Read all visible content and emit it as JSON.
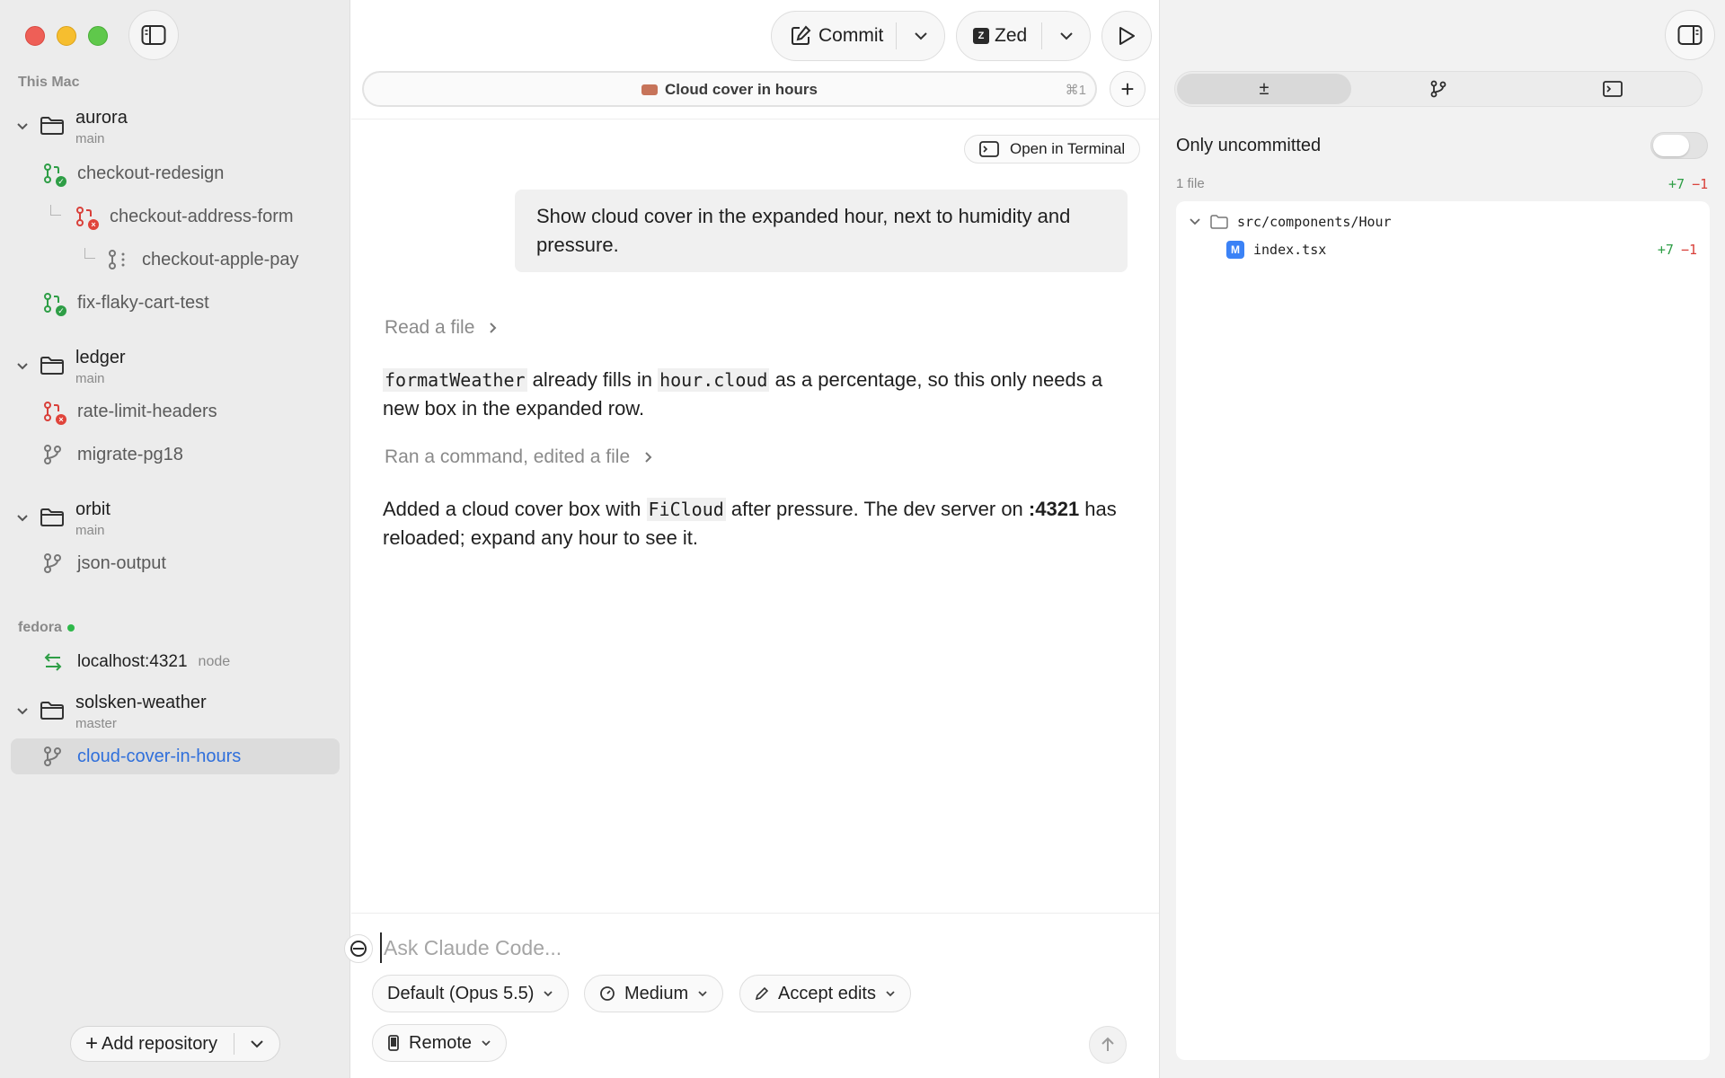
{
  "sidebar": {
    "section_this_mac": "This Mac",
    "repos": [
      {
        "name": "aurora",
        "branch": "main"
      },
      {
        "name": "ledger",
        "branch": "main"
      },
      {
        "name": "orbit",
        "branch": "main"
      },
      {
        "name": "solsken-weather",
        "branch": "master"
      }
    ],
    "branches": {
      "checkout_redesign": "checkout-redesign",
      "checkout_address_form": "checkout-address-form",
      "checkout_apple_pay": "checkout-apple-pay",
      "fix_flaky_cart_test": "fix-flaky-cart-test",
      "rate_limit_headers": "rate-limit-headers",
      "migrate_pg18": "migrate-pg18",
      "json_output": "json-output",
      "cloud_cover_in_hours": "cloud-cover-in-hours"
    },
    "host_section": "fedora",
    "host_status_color": "#2eb84a",
    "localhost": {
      "label": "localhost:4321",
      "process": "node"
    },
    "add_repository": "Add repository"
  },
  "toolbar": {
    "commit_label": "Commit",
    "editor_label": "Zed"
  },
  "tab": {
    "title": "Cloud cover in hours",
    "shortcut": "⌘1"
  },
  "conversation": {
    "open_in_terminal": "Open in Terminal",
    "user_message": "Show cloud cover in the expanded hour, next to humidity and pressure.",
    "step1": "Read a file",
    "msg1": {
      "code1": "formatWeather",
      "t1": " already fills in ",
      "code2": "hour.cloud",
      "t2": " as a percentage, so this only needs a new box in the expanded row."
    },
    "step2": "Ran a command, edited a file",
    "msg2": {
      "t1": "Added a cloud cover box with ",
      "code1": "FiCloud",
      "t2": " after pressure. The dev server on ",
      "bold1": ":4321",
      "t3": " has reloaded; expand any hour to see it."
    }
  },
  "composer": {
    "placeholder": "Ask Claude Code...",
    "model": "Default (Opus 5.5)",
    "effort": "Medium",
    "permission": "Accept edits",
    "environment": "Remote"
  },
  "right_panel": {
    "tabs": [
      "±",
      "branch-icon",
      "terminal-icon"
    ],
    "only_uncommitted": "Only uncommitted",
    "file_count": "1 file",
    "total_add": "+7",
    "total_del": "−1",
    "dir": "src/components/Hour",
    "file": {
      "badge": "M",
      "name": "index.tsx",
      "add": "+7",
      "del": "−1"
    }
  },
  "colors": {
    "accent_link": "#2f6fdb",
    "add_green": "#2e9e46",
    "del_red": "#d9403a"
  }
}
